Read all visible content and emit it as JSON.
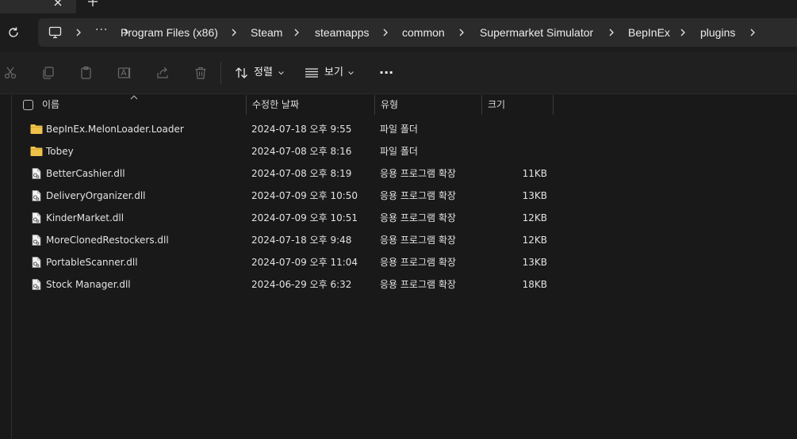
{
  "breadcrumbs": [
    "Program Files (x86)",
    "Steam",
    "steamapps",
    "common",
    "Supermarket Simulator",
    "BepInEx",
    "plugins"
  ],
  "breadcrumb_overflow": "···",
  "toolbar": {
    "sort_label": "정렬",
    "view_label": "보기",
    "more": "···"
  },
  "columns": {
    "name": "이름",
    "date": "수정한 날짜",
    "type": "유형",
    "size": "크기"
  },
  "files": [
    {
      "name": "BepInEx.MelonLoader.Loader",
      "date": "2024-07-18 오후 9:55",
      "type": "파일 폴더",
      "size": "",
      "icon": "folder-icon"
    },
    {
      "name": "Tobey",
      "date": "2024-07-08 오후 8:16",
      "type": "파일 폴더",
      "size": "",
      "icon": "folder-icon"
    },
    {
      "name": "BetterCashier.dll",
      "date": "2024-07-08 오후 8:19",
      "type": "응용 프로그램 확장",
      "size": "11KB",
      "icon": "dll-file-icon"
    },
    {
      "name": "DeliveryOrganizer.dll",
      "date": "2024-07-09 오후 10:50",
      "type": "응용 프로그램 확장",
      "size": "13KB",
      "icon": "dll-file-icon"
    },
    {
      "name": "KinderMarket.dll",
      "date": "2024-07-09 오후 10:51",
      "type": "응용 프로그램 확장",
      "size": "12KB",
      "icon": "dll-file-icon"
    },
    {
      "name": "MoreClonedRestockers.dll",
      "date": "2024-07-18 오후 9:48",
      "type": "응용 프로그램 확장",
      "size": "12KB",
      "icon": "dll-file-icon"
    },
    {
      "name": "PortableScanner.dll",
      "date": "2024-07-09 오후 11:04",
      "type": "응용 프로그램 확장",
      "size": "13KB",
      "icon": "dll-file-icon"
    },
    {
      "name": "Stock Manager.dll",
      "date": "2024-06-29 오후 6:32",
      "type": "응용 프로그램 확장",
      "size": "18KB",
      "icon": "dll-file-icon"
    }
  ],
  "colors": {
    "background": "#191919",
    "folder": "#f0c24a",
    "text": "#e2e2e2"
  }
}
